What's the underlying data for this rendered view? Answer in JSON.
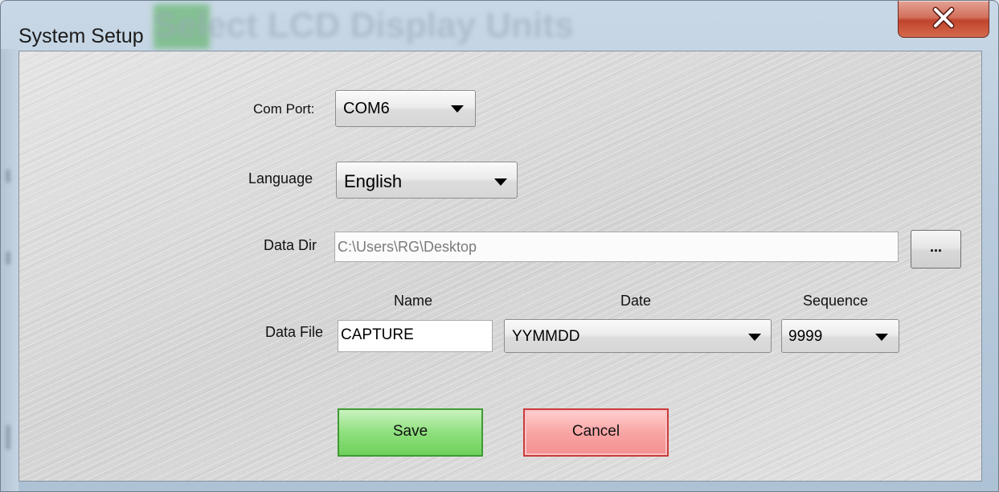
{
  "window": {
    "title": "System Setup",
    "background_title": "Select LCD Display Units"
  },
  "com_port": {
    "label": "Com Port:",
    "value": "COM6"
  },
  "language": {
    "label": "Language",
    "value": "English"
  },
  "data_dir": {
    "label": "Data Dir",
    "value": "C:\\Users\\RG\\Desktop",
    "browse_label": "..."
  },
  "data_file": {
    "label": "Data File",
    "name_header": "Name",
    "date_header": "Date",
    "sequence_header": "Sequence",
    "name_value": "CAPTURE",
    "date_value": "YYMMDD",
    "sequence_value": "9999"
  },
  "buttons": {
    "save": "Save",
    "cancel": "Cancel"
  },
  "colors": {
    "save_accent": "#6fd15b",
    "cancel_accent": "#f58f8f",
    "close_accent": "#c0442c"
  },
  "icons": {
    "close": "close-icon",
    "dropdown": "chevron-down-icon"
  }
}
